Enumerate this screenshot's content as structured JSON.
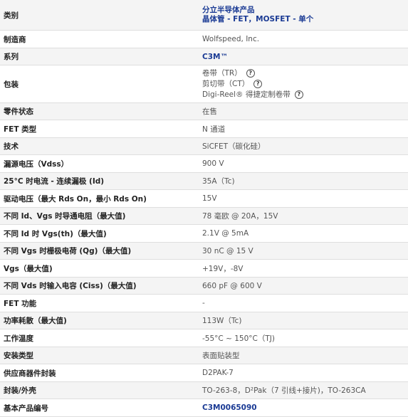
{
  "rows": [
    {
      "label": "类别",
      "values": [
        "分立半导体产品",
        "晶体管 - FET，MOSFET - 单个"
      ],
      "style": "link"
    },
    {
      "label": "制造商",
      "value": "Wolfspeed, Inc."
    },
    {
      "label": "系列",
      "value": "C3M™",
      "style": "link"
    },
    {
      "label": "包装",
      "packaging": [
        {
          "text": "卷带（TR）",
          "icon": "question-circle-icon"
        },
        {
          "text": "剪切带（CT）",
          "icon": "question-circle-icon"
        },
        {
          "text": "Digi-Reel® 得捷定制卷带",
          "icon": "question-circle-icon"
        }
      ]
    },
    {
      "label": "零件状态",
      "value": "在售"
    },
    {
      "label": "FET 类型",
      "value": "N 通道"
    },
    {
      "label": "技术",
      "value": "SiCFET（碳化硅）"
    },
    {
      "label": "漏源电压（Vdss）",
      "value": "900 V"
    },
    {
      "label": "25°C 时电流 - 连续漏极 (Id)",
      "value": "35A（Tc)"
    },
    {
      "label": "驱动电压（最大 Rds On，最小 Rds On)",
      "value": "15V"
    },
    {
      "label": "不同 Id、Vgs 时导通电阻（最大值)",
      "value": "78 毫欧 @ 20A，15V"
    },
    {
      "label": "不同 Id 时 Vgs(th)（最大值)",
      "value": "2.1V @ 5mA"
    },
    {
      "label": "不同 Vgs 时栅极电荷 (Qg)（最大值)",
      "value": "30 nC @ 15 V"
    },
    {
      "label": "Vgs（最大值)",
      "value": "+19V，-8V"
    },
    {
      "label": "不同 Vds 时输入电容 (Ciss)（最大值)",
      "value": "660 pF @ 600 V"
    },
    {
      "label": "FET 功能",
      "value": "-"
    },
    {
      "label": "功率耗散（最大值)",
      "value": "113W（Tc)"
    },
    {
      "label": "工作温度",
      "value": "-55°C ~ 150°C（TJ)"
    },
    {
      "label": "安装类型",
      "value": "表面贴装型"
    },
    {
      "label": "供应商器件封装",
      "value": "D2PAK-7"
    },
    {
      "label": "封装/外壳",
      "value": "TO-263-8，D²Pak（7 引线+接片)，TO-263CA"
    },
    {
      "label": "基本产品编号",
      "value": "C3M0065090",
      "style": "link"
    }
  ],
  "colors": {
    "link": "#1a3a94",
    "shade": "#f4f4f4",
    "border": "#dedede"
  }
}
